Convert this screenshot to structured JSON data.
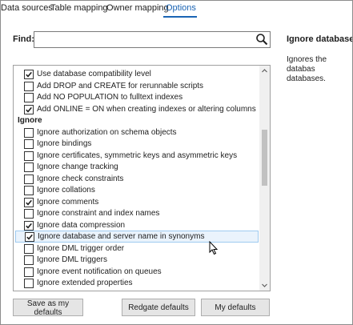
{
  "tabs": [
    {
      "label": "Data sources"
    },
    {
      "label": "Table mapping"
    },
    {
      "label": "Owner mapping"
    },
    {
      "label": "Options",
      "active": true
    }
  ],
  "find": {
    "label": "Find:",
    "value": "",
    "placeholder": ""
  },
  "icons": {
    "search": "search-icon",
    "checkmark": "checkmark-icon",
    "cursor": "mouse-cursor-icon"
  },
  "options": [
    {
      "label": "Use database compatibility level",
      "checked": true
    },
    {
      "label": "Add DROP and CREATE for rerunnable scripts",
      "checked": false
    },
    {
      "label": "Add NO POPULATION to fulltext indexes",
      "checked": false
    },
    {
      "label": "Add ONLINE = ON when creating indexes or altering columns",
      "checked": true
    },
    {
      "label": "Ignore",
      "group": true
    },
    {
      "label": "Ignore authorization on schema objects",
      "checked": false
    },
    {
      "label": "Ignore bindings",
      "checked": false
    },
    {
      "label": "Ignore certificates, symmetric keys and asymmetric keys",
      "checked": false
    },
    {
      "label": "Ignore change tracking",
      "checked": false
    },
    {
      "label": "Ignore check constraints",
      "checked": false
    },
    {
      "label": "Ignore collations",
      "checked": false
    },
    {
      "label": "Ignore comments",
      "checked": true
    },
    {
      "label": "Ignore constraint and index names",
      "checked": false
    },
    {
      "label": "Ignore data compression",
      "checked": true
    },
    {
      "label": "Ignore database and server name in synonyms",
      "checked": true,
      "selected": true
    },
    {
      "label": "Ignore DML trigger order",
      "checked": false
    },
    {
      "label": "Ignore DML triggers",
      "checked": false
    },
    {
      "label": "Ignore event notification on queues",
      "checked": false
    },
    {
      "label": "Ignore extended properties",
      "checked": false
    }
  ],
  "details": {
    "title": "Ignore database and server name in synonyms",
    "title_visible": "Ignore database ar",
    "description": "Ignores the database and server name in synonyms",
    "description_visible": "Ignores the databas databases."
  },
  "buttons": {
    "save_defaults": "Save as my defaults",
    "redgate_defaults": "Redgate defaults",
    "my_defaults": "My defaults"
  },
  "colors": {
    "accent": "#1a64b4",
    "selection_bg": "#eaf3fc",
    "selection_border": "#9ecaf0"
  }
}
